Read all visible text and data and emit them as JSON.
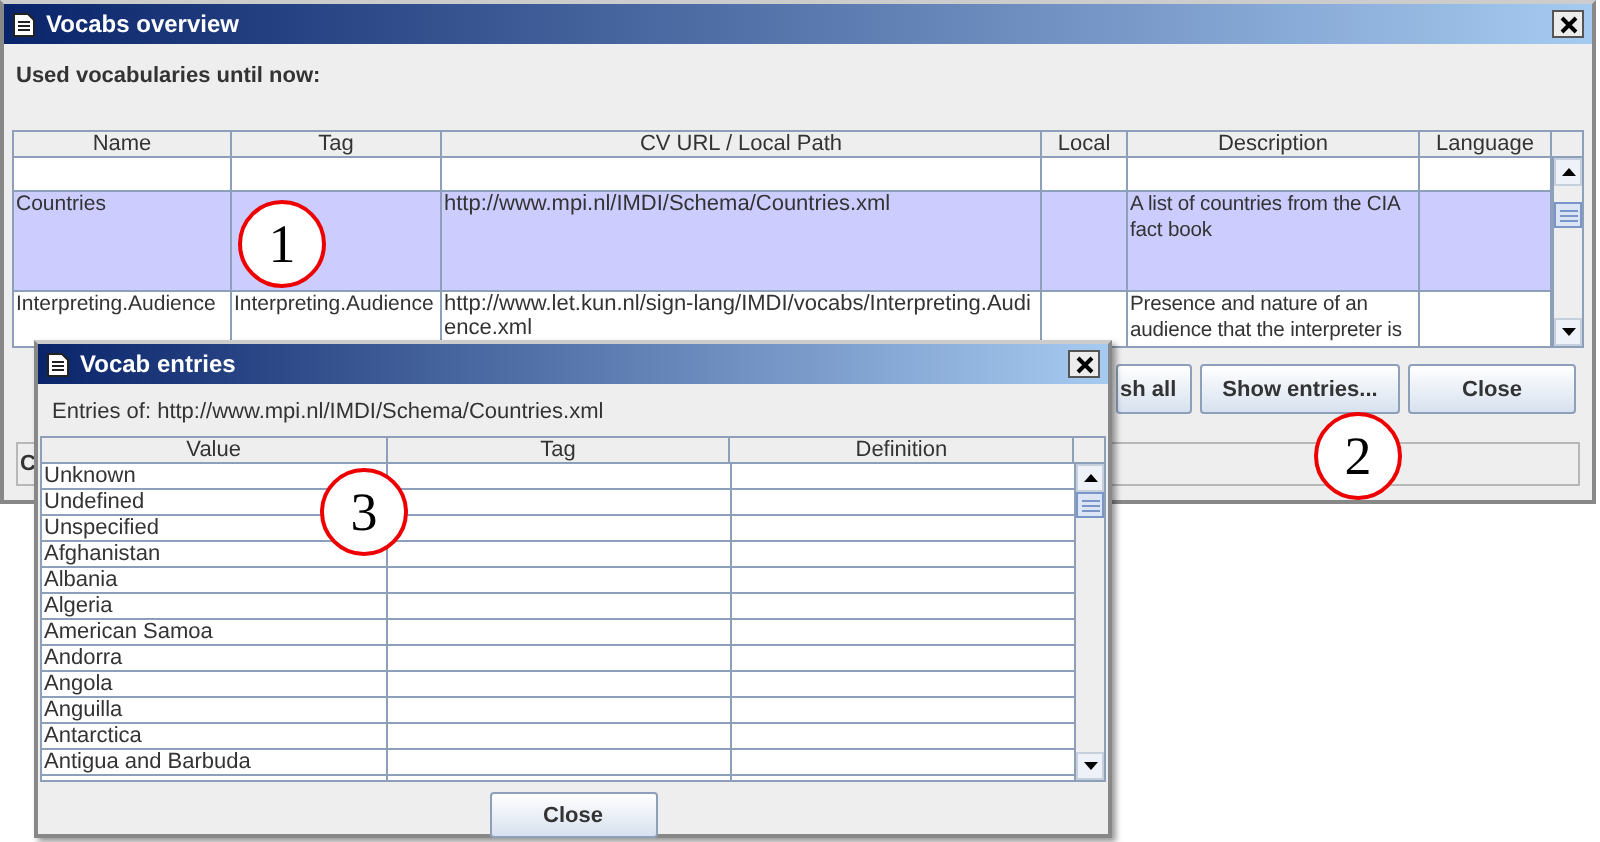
{
  "main_window": {
    "title": "Vocabs overview",
    "heading": "Used vocabularies until now:",
    "table": {
      "columns": [
        "Name",
        "Tag",
        "CV URL / Local Path",
        "Local",
        "Description",
        "Language"
      ],
      "rows": [
        {
          "selected": false
        },
        {
          "selected": true,
          "name": "Countries",
          "cv_url": "http://www.mpi.nl/IMDI/Schema/Countries.xml",
          "description": "A list of countries from the CIA fact book"
        },
        {
          "selected": false,
          "name": "Interpreting.Audience",
          "tag": "Interpreting.Audience",
          "cv_url": "http://www.let.kun.nl/sign-lang/IMDI/vocabs/Interpreting.Audience.xml",
          "description": "Presence and nature of an audience that the interpreter is"
        }
      ]
    },
    "buttons": [
      "sh all",
      "Show entries...",
      "Close"
    ],
    "status_bar": "C"
  },
  "dialog": {
    "title": "Vocab entries",
    "entries_label": "Entries of: http://www.mpi.nl/IMDI/Schema/Countries.xml",
    "table": {
      "columns": [
        "Value",
        "Tag",
        "Definition"
      ],
      "rows": [
        {
          "value": "Unknown"
        },
        {
          "value": "Undefined"
        },
        {
          "value": "Unspecified"
        },
        {
          "value": "Afghanistan"
        },
        {
          "value": "Albania"
        },
        {
          "value": "Algeria"
        },
        {
          "value": "American Samoa"
        },
        {
          "value": "Andorra"
        },
        {
          "value": "Angola"
        },
        {
          "value": "Anguilla"
        },
        {
          "value": "Antarctica"
        },
        {
          "value": "Antigua and Barbuda"
        }
      ]
    },
    "button": "Close"
  },
  "callouts": [
    {
      "label": "1"
    },
    {
      "label": "2"
    },
    {
      "label": "3"
    }
  ]
}
